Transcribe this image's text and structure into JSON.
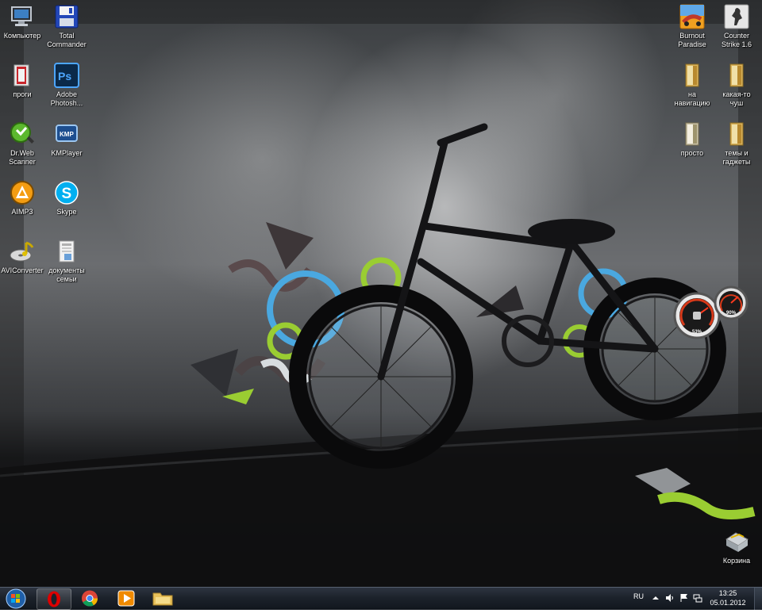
{
  "desktop_icons": [
    {
      "label": "Компьютер"
    },
    {
      "label": "Total\nCommander"
    },
    {
      "label": "проги"
    },
    {
      "label": "Adobe\nPhotosh..."
    },
    {
      "label": "Dr.Web\nScanner"
    },
    {
      "label": "KMPlayer"
    },
    {
      "label": "AIMP3"
    },
    {
      "label": "Skype"
    },
    {
      "label": "AVIConverter"
    },
    {
      "label": "документы\nсемьи"
    },
    {
      "label": "Burnout\nParadise"
    },
    {
      "label": "Counter\nStrike 1.6"
    },
    {
      "label": "на\nнавигацию"
    },
    {
      "label": "какая-то\nчуш"
    },
    {
      "label": "просто"
    },
    {
      "label": "темы и\nгаджеты"
    },
    {
      "label": "Корзина"
    }
  ],
  "gadget": {
    "cpu_percent": "53%",
    "memory_percent": "90%"
  },
  "taskbar": {
    "pinned_icons": [
      "opera-icon",
      "chrome-icon",
      "media-player-icon",
      "folder-icon"
    ],
    "language": "RU",
    "time": "13:25",
    "date": "05.01.2012"
  },
  "colors": {
    "taskbar": "#1c222b",
    "accent_green": "#9acd32",
    "accent_blue": "#4aa8e0"
  }
}
